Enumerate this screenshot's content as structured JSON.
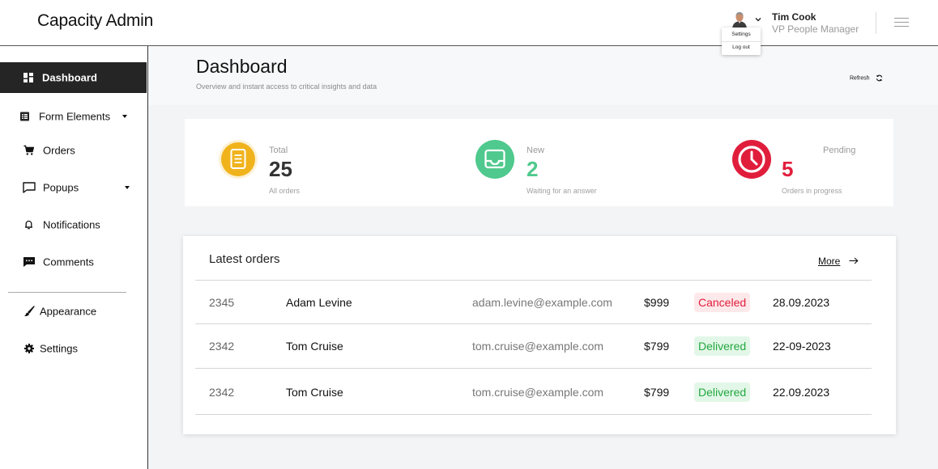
{
  "app": {
    "title": "Capacity Admin"
  },
  "user": {
    "name": "Tim Cook",
    "role": "VP People Manager",
    "menu": {
      "settings": "Settings",
      "logout": "Log out"
    }
  },
  "sidebar": {
    "items": [
      {
        "label": "Dashboard",
        "icon": "dashboard-icon",
        "active": true
      },
      {
        "label": "Form Elements",
        "icon": "form-icon",
        "has_submenu": true
      },
      {
        "label": "Orders",
        "icon": "cart-icon"
      },
      {
        "label": "Popups",
        "icon": "popup-icon",
        "has_submenu": true
      },
      {
        "label": "Notifications",
        "icon": "bell-icon"
      },
      {
        "label": "Comments",
        "icon": "comment-icon"
      },
      {
        "label": "Appearance",
        "icon": "brush-icon"
      },
      {
        "label": "Settings",
        "icon": "gear-icon"
      }
    ]
  },
  "page": {
    "title": "Dashboard",
    "subtitle": "Overview and instant access to critical insights and data",
    "refresh_label": "Refresh"
  },
  "stats": [
    {
      "label": "Total",
      "value": "25",
      "note": "All orders",
      "color": "#f0b31c",
      "icon": "document-icon"
    },
    {
      "label": "New",
      "value": "2",
      "note": "Waiting for an answer",
      "color": "#4fc98d",
      "icon": "inbox-icon"
    },
    {
      "label": "Pending",
      "value": "5",
      "note": "Orders in progress",
      "color": "#e01e3c",
      "icon": "clock-icon"
    }
  ],
  "orders": {
    "title": "Latest orders",
    "more_label": "More",
    "rows": [
      {
        "id": "2345",
        "name": "Adam Levine",
        "email": "adam.levine@example.com",
        "amount": "$999",
        "status": "Canceled",
        "date": "28.09.2023"
      },
      {
        "id": "2342",
        "name": "Tom Cruise",
        "email": "tom.cruise@example.com",
        "amount": "$799",
        "status": "Delivered",
        "date": "22-09-2023"
      },
      {
        "id": "2342",
        "name": "Tom Cruise",
        "email": "tom.cruise@example.com",
        "amount": "$799",
        "status": "Delivered",
        "date": "22.09.2023"
      }
    ]
  },
  "colors": {
    "sidebar_active_bg": "#252525",
    "canceled_bg": "#fde8ea",
    "canceled_text": "#e01e3c",
    "delivered_bg": "#e3f7e8",
    "delivered_text": "#23a840"
  }
}
